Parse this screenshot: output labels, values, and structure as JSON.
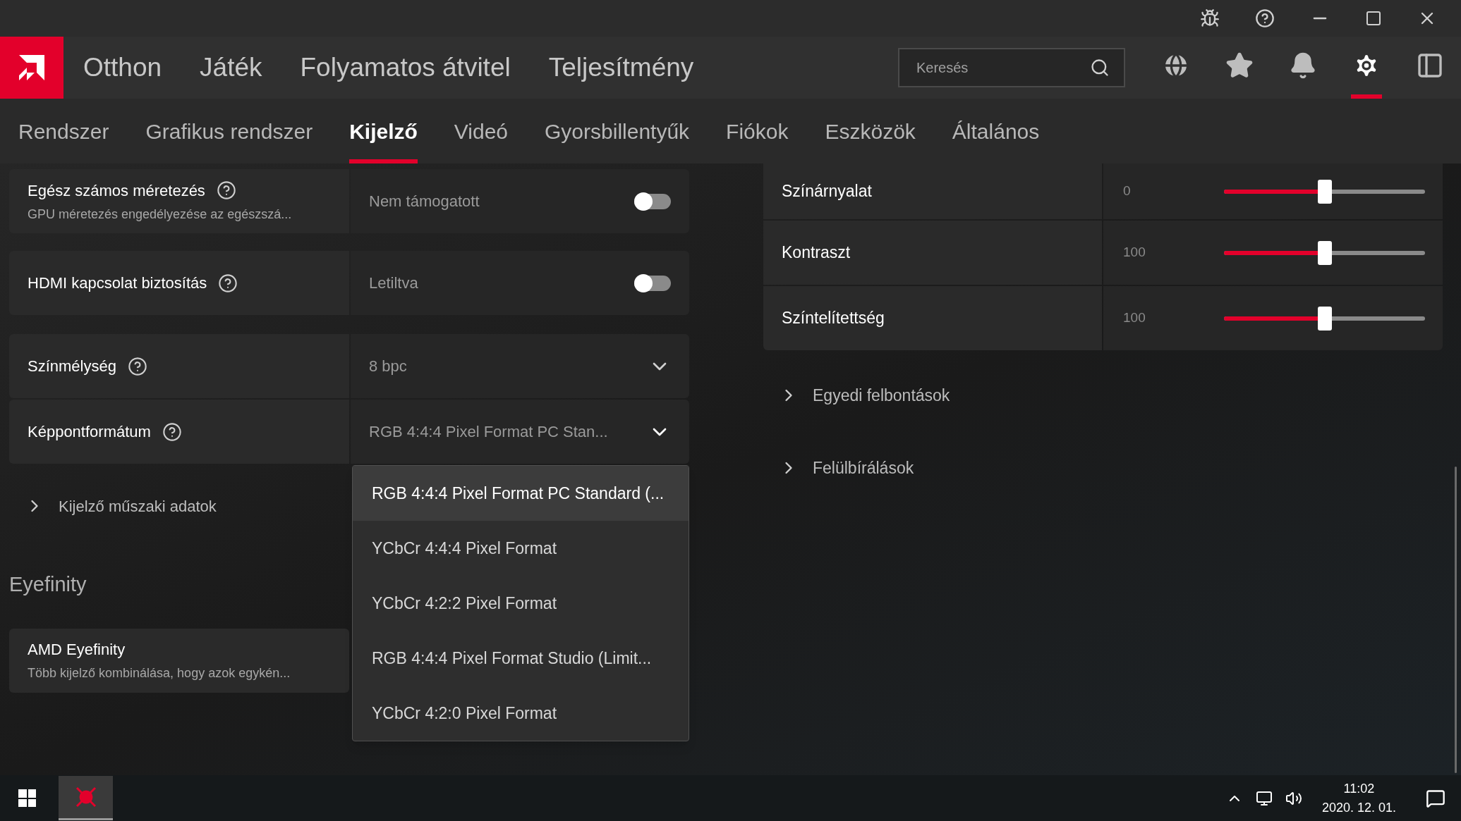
{
  "nav": {
    "items": [
      {
        "label": "Otthon"
      },
      {
        "label": "Játék"
      },
      {
        "label": "Folyamatos átvitel"
      },
      {
        "label": "Teljesítmény"
      }
    ],
    "search": {
      "placeholder": "Keresés"
    },
    "icon_buttons": [
      {
        "kind": "globe",
        "selected": false
      },
      {
        "kind": "star",
        "selected": false
      },
      {
        "kind": "bell",
        "selected": false
      },
      {
        "kind": "gear",
        "selected": true
      },
      {
        "kind": "panel",
        "selected": false
      }
    ]
  },
  "tabs": [
    {
      "label": "Rendszer",
      "selected": false
    },
    {
      "label": "Grafikus rendszer",
      "selected": false
    },
    {
      "label": "Kijelző",
      "selected": true
    },
    {
      "label": "Videó",
      "selected": false
    },
    {
      "label": "Gyorsbillentyűk",
      "selected": false
    },
    {
      "label": "Fiókok",
      "selected": false
    },
    {
      "label": "Eszközök",
      "selected": false
    },
    {
      "label": "Általános",
      "selected": false
    }
  ],
  "left_settings": [
    {
      "kind": "toggle",
      "label": "Egész számos méretezés",
      "description": "GPU méretezés engedélyezése az egészszá...",
      "value": "Nem támogatott",
      "on": false
    },
    {
      "kind": "toggle",
      "label": "HDMI kapcsolat biztosítás",
      "value": "Letiltva",
      "on": false
    },
    {
      "kind": "dropdown",
      "label": "Színmélység",
      "value": "8 bpc",
      "expanded": false
    },
    {
      "kind": "dropdown",
      "label": "Képpontformátum",
      "value": "RGB 4:4:4 Pixel Format PC Stan...",
      "expanded": true
    }
  ],
  "pixel_format_menu": [
    {
      "label": "RGB 4:4:4 Pixel Format PC Standard (...",
      "selected": true
    },
    {
      "label": "YCbCr 4:4:4 Pixel Format",
      "selected": false
    },
    {
      "label": "YCbCr 4:2:2 Pixel Format",
      "selected": false
    },
    {
      "label": "RGB 4:4:4 Pixel Format Studio (Limit...",
      "selected": false
    },
    {
      "label": "YCbCr 4:2:0 Pixel Format",
      "selected": false
    }
  ],
  "left_expander": {
    "label": "Kijelző műszaki adatok"
  },
  "eyefinity": {
    "heading": "Eyefinity",
    "label": "AMD Eyefinity",
    "description": "Több kijelző kombinálása, hogy azok egykén..."
  },
  "right_sliders": [
    {
      "label": "Színárnyalat",
      "reading": "0",
      "level": 0.5
    },
    {
      "label": "Kontraszt",
      "reading": "100",
      "level": 0.5
    },
    {
      "label": "Színtelítettség",
      "reading": "100",
      "level": 0.5
    }
  ],
  "right_expanders": [
    {
      "label": "Egyedi felbontások"
    },
    {
      "label": "Felülbírálások"
    }
  ],
  "taskbar": {
    "time": "11:02",
    "date": "2020. 12. 01."
  }
}
